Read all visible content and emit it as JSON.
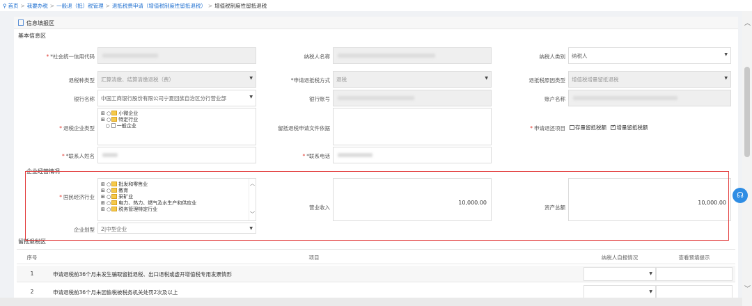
{
  "breadcrumb": {
    "home": "首页",
    "items": [
      "我要办税",
      "一般退（抵）税管理",
      "退抵税费申请（增值税制度性留抵退税）"
    ],
    "current": "增值税制度性留抵退税"
  },
  "panel_title": "信息填报区",
  "basic": {
    "title": "基本信息区",
    "credit_code_label": "*社会统一信用代码",
    "taxpayer_name_label": "纳税人名称",
    "taxpayer_type_label": "纳税人类别",
    "taxpayer_type_value": "纳税人",
    "refund_type_label": "退税种类型",
    "refund_type_value": "汇算清缴、结算清缴退税（费）",
    "method_label": "*申请退抵税方式",
    "method_value": "退税",
    "reason_label": "退抵税原因类型",
    "reason_value": "增值税增量留抵退税",
    "bank_label": "银行名称",
    "bank_value": "中国工商银行股份有限公司宁夏回族自治区分行营业部",
    "account_label": "银行账号",
    "account_name_label": "账户名称",
    "enterprise_type_label": "退税企业类型",
    "enterprise_tree": [
      "小微企业",
      "特定行业",
      "一般企业"
    ],
    "doc_basis_label": "留抵退税申请文件依据",
    "apply_item_label": "申请退还项目",
    "apply_opt1": "存量留抵税额",
    "apply_opt2": "增量留抵税额",
    "contact_label": "*联系人姓名",
    "phone_label": "*联系电话"
  },
  "business": {
    "title": "企业经营情况",
    "industry_label": "国民经济行业",
    "industry_tree": [
      "批发和零售业",
      "教育",
      "采矿业",
      "电力、热力、燃气及水生产和供应业",
      "税务管理特定行业"
    ],
    "revenue_label": "营业收入",
    "revenue_value": "10,000.00",
    "assets_label": "资产总额",
    "assets_value": "10,000.00",
    "scale_label": "企业划型",
    "scale_value": "2|中型企业"
  },
  "refund": {
    "title": "留抵退税区",
    "headers": [
      "序号",
      "项目",
      "纳税人自报情况",
      "查看预填提示"
    ],
    "rows": [
      {
        "no": "1",
        "item": "申请退税前36个月未发生骗取留抵退税、出口退税或虚开增值税专用发票情形"
      },
      {
        "no": "2",
        "item": "申请退税前36个月未因偷税被税务机关处罚2次及以上"
      }
    ]
  }
}
